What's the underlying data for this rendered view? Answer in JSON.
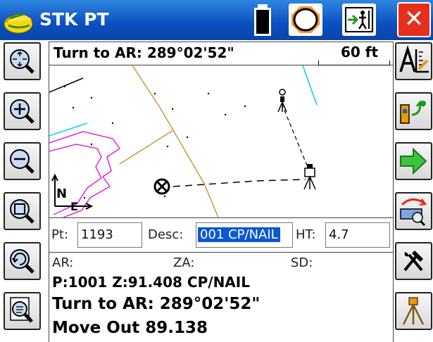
{
  "app": {
    "title": "STK PT"
  },
  "info_bar": {
    "turn_text": "Turn to AR: 289°02'52\"",
    "scale": "60 ft"
  },
  "map": {
    "north_label": "N",
    "east_label": "E"
  },
  "fields": {
    "pt_label": "Pt:",
    "pt_value": "1193",
    "desc_label": "Desc:",
    "desc_value": "001 CP/NAIL",
    "ht_label": "HT:",
    "ht_value": "4.7"
  },
  "readout": {
    "ar_label": "AR:",
    "za_label": "ZA:",
    "sd_label": "SD:",
    "point_line": "P:1001 Z:91.408 CP/NAIL",
    "turn_line": "Turn to AR: 289°02'52\"",
    "move_line": "Move Out 89.138"
  },
  "icons": {
    "left": [
      "zoom-extents-icon",
      "zoom-in-icon",
      "zoom-out-icon",
      "zoom-window-icon",
      "zoom-previous-icon",
      "zoom-settings-icon"
    ],
    "right": [
      "cad-toolbar-icon",
      "instrument-setup-icon",
      "next-arrow-icon",
      "measure-icon",
      "tools-icon",
      "tripod-icon"
    ]
  },
  "colors": {
    "titlebar": "#0b4fbf",
    "close": "#e62f1d",
    "selection": "#0b58d2"
  }
}
